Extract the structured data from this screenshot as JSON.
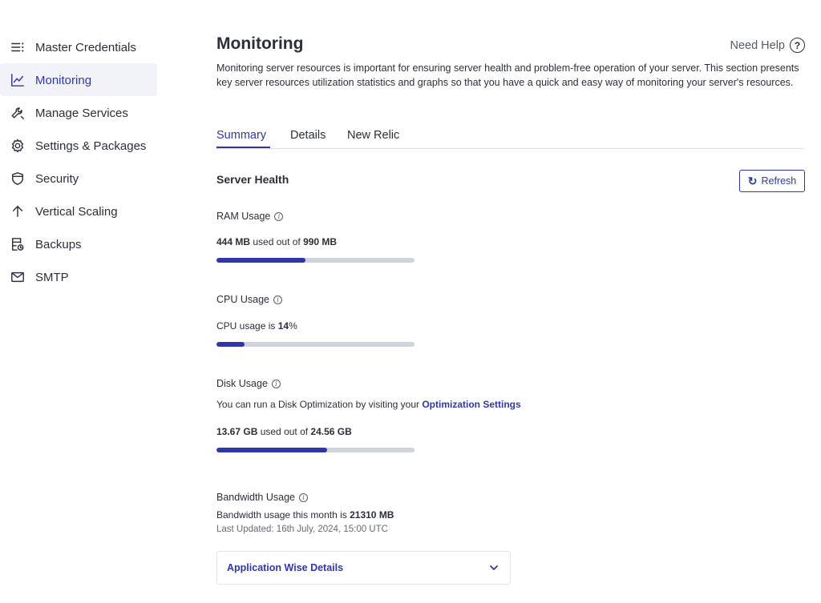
{
  "sidebar": {
    "items": [
      {
        "label": "Master Credentials",
        "icon": "list-icon",
        "active": false
      },
      {
        "label": "Monitoring",
        "icon": "chart-line-icon",
        "active": true
      },
      {
        "label": "Manage Services",
        "icon": "wrench-icon",
        "active": false
      },
      {
        "label": "Settings & Packages",
        "icon": "gear-icon",
        "active": false
      },
      {
        "label": "Security",
        "icon": "shield-icon",
        "active": false
      },
      {
        "label": "Vertical Scaling",
        "icon": "arrow-up-icon",
        "active": false
      },
      {
        "label": "Backups",
        "icon": "backup-icon",
        "active": false
      },
      {
        "label": "SMTP",
        "icon": "mail-icon",
        "active": false
      }
    ]
  },
  "header": {
    "title": "Monitoring",
    "help_label": "Need Help",
    "help_icon": "?",
    "description": "Monitoring server resources is important for ensuring server health and problem-free operation of your server. This section presents key server resources utilization statistics and graphs so that you have a quick and easy way of monitoring your server's resources."
  },
  "tabs": [
    {
      "label": "Summary",
      "active": true
    },
    {
      "label": "Details",
      "active": false
    },
    {
      "label": "New Relic",
      "active": false
    }
  ],
  "server_health": {
    "title": "Server Health",
    "refresh_label": "Refresh",
    "refresh_icon": "↻",
    "ram": {
      "label": "RAM Usage",
      "used": "444 MB",
      "middle": " used out of ",
      "total": "990 MB",
      "fraction": 0.45
    },
    "cpu": {
      "label": "CPU Usage",
      "prefix": "CPU usage is ",
      "value": "14",
      "suffix": "%",
      "fraction": 0.14
    },
    "disk": {
      "label": "Disk Usage",
      "hint_prefix": "You can run a Disk Optimization by visiting your ",
      "hint_link": "Optimization Settings",
      "used": "13.67 GB",
      "middle": " used out of ",
      "total": "24.56 GB",
      "fraction": 0.557
    },
    "bandwidth": {
      "label": "Bandwidth Usage",
      "prefix": "Bandwidth usage this month is ",
      "value": "21310 MB",
      "updated": "Last Updated: 16th July, 2024, 15:00 UTC"
    },
    "accordion_label": "Application Wise Details"
  },
  "colors": {
    "accent": "#2f37a8",
    "track": "#cfd3dc",
    "active_bg": "#f1f3f8"
  }
}
